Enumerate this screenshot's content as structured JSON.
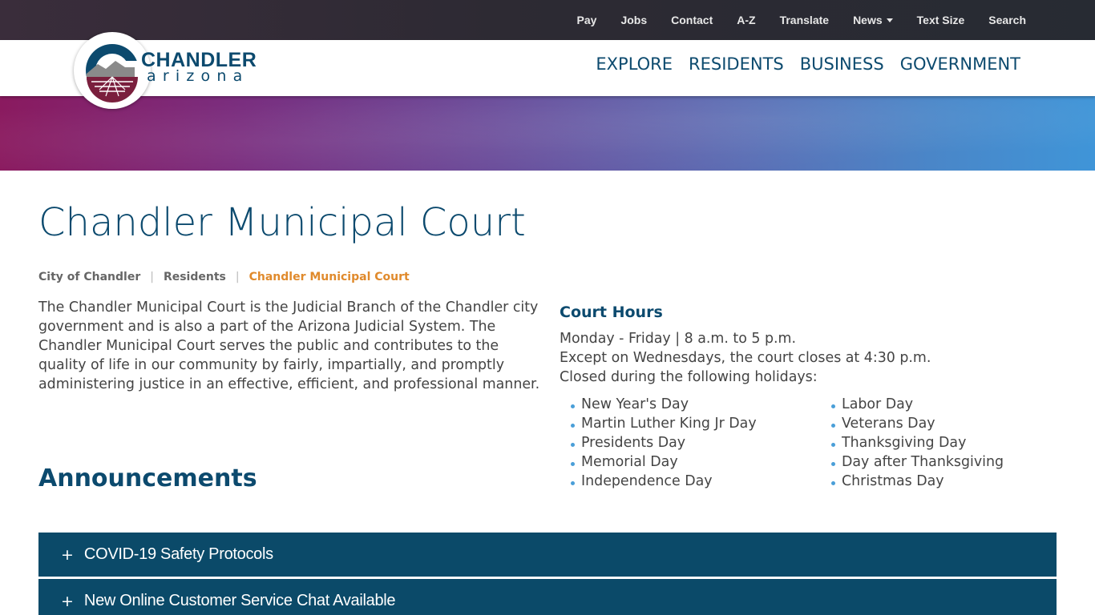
{
  "utility_nav": {
    "items": [
      "Pay",
      "Jobs",
      "Contact",
      "A-Z",
      "Translate",
      "News",
      "Text Size",
      "Search"
    ]
  },
  "logo": {
    "name_line_1": "CHANDLER",
    "name_line_2": "arizona"
  },
  "main_nav": {
    "items": [
      "EXPLORE",
      "RESIDENTS",
      "BUSINESS",
      "GOVERNMENT"
    ]
  },
  "page": {
    "title": "Chandler Municipal Court",
    "breadcrumb": [
      "City of Chandler",
      "Residents",
      "Chandler Municipal Court"
    ],
    "intro": "The Chandler Municipal Court is the Judicial Branch of the Chandler city government and is also a part of the Arizona Judicial System. The Chandler Municipal Court serves the public and contributes to the quality of life in our community by fairly, impartially, and promptly administering justice in an effective, efficient, and professional manner."
  },
  "court_hours": {
    "title": "Court Hours",
    "lines": [
      "Monday - Friday | 8 a.m. to 5 p.m.",
      "Except on Wednesdays, the court closes at 4:30 p.m.",
      "Closed during the following holidays:"
    ],
    "holidays_left": [
      "New Year's Day",
      "Martin Luther King Jr Day",
      "Presidents Day",
      "Memorial Day",
      "Independence Day"
    ],
    "holidays_right": [
      "Labor Day",
      "Veterans Day",
      "Thanksgiving Day",
      "Day after Thanksgiving",
      "Christmas Day"
    ]
  },
  "announcements": {
    "title": "Announcements",
    "items": [
      {
        "icon": "+",
        "title": "COVID-19 Safety Protocols"
      },
      {
        "icon": "+",
        "title": "New Online Customer Service Chat Available"
      }
    ]
  },
  "colors": {
    "brand_navy": "#0c4a6e",
    "accordion_bg": "#0b4a69",
    "breadcrumb_active": "#e08a2c",
    "bullet": "#4a9fd8",
    "logo_maroon": "#7a1f3d"
  }
}
